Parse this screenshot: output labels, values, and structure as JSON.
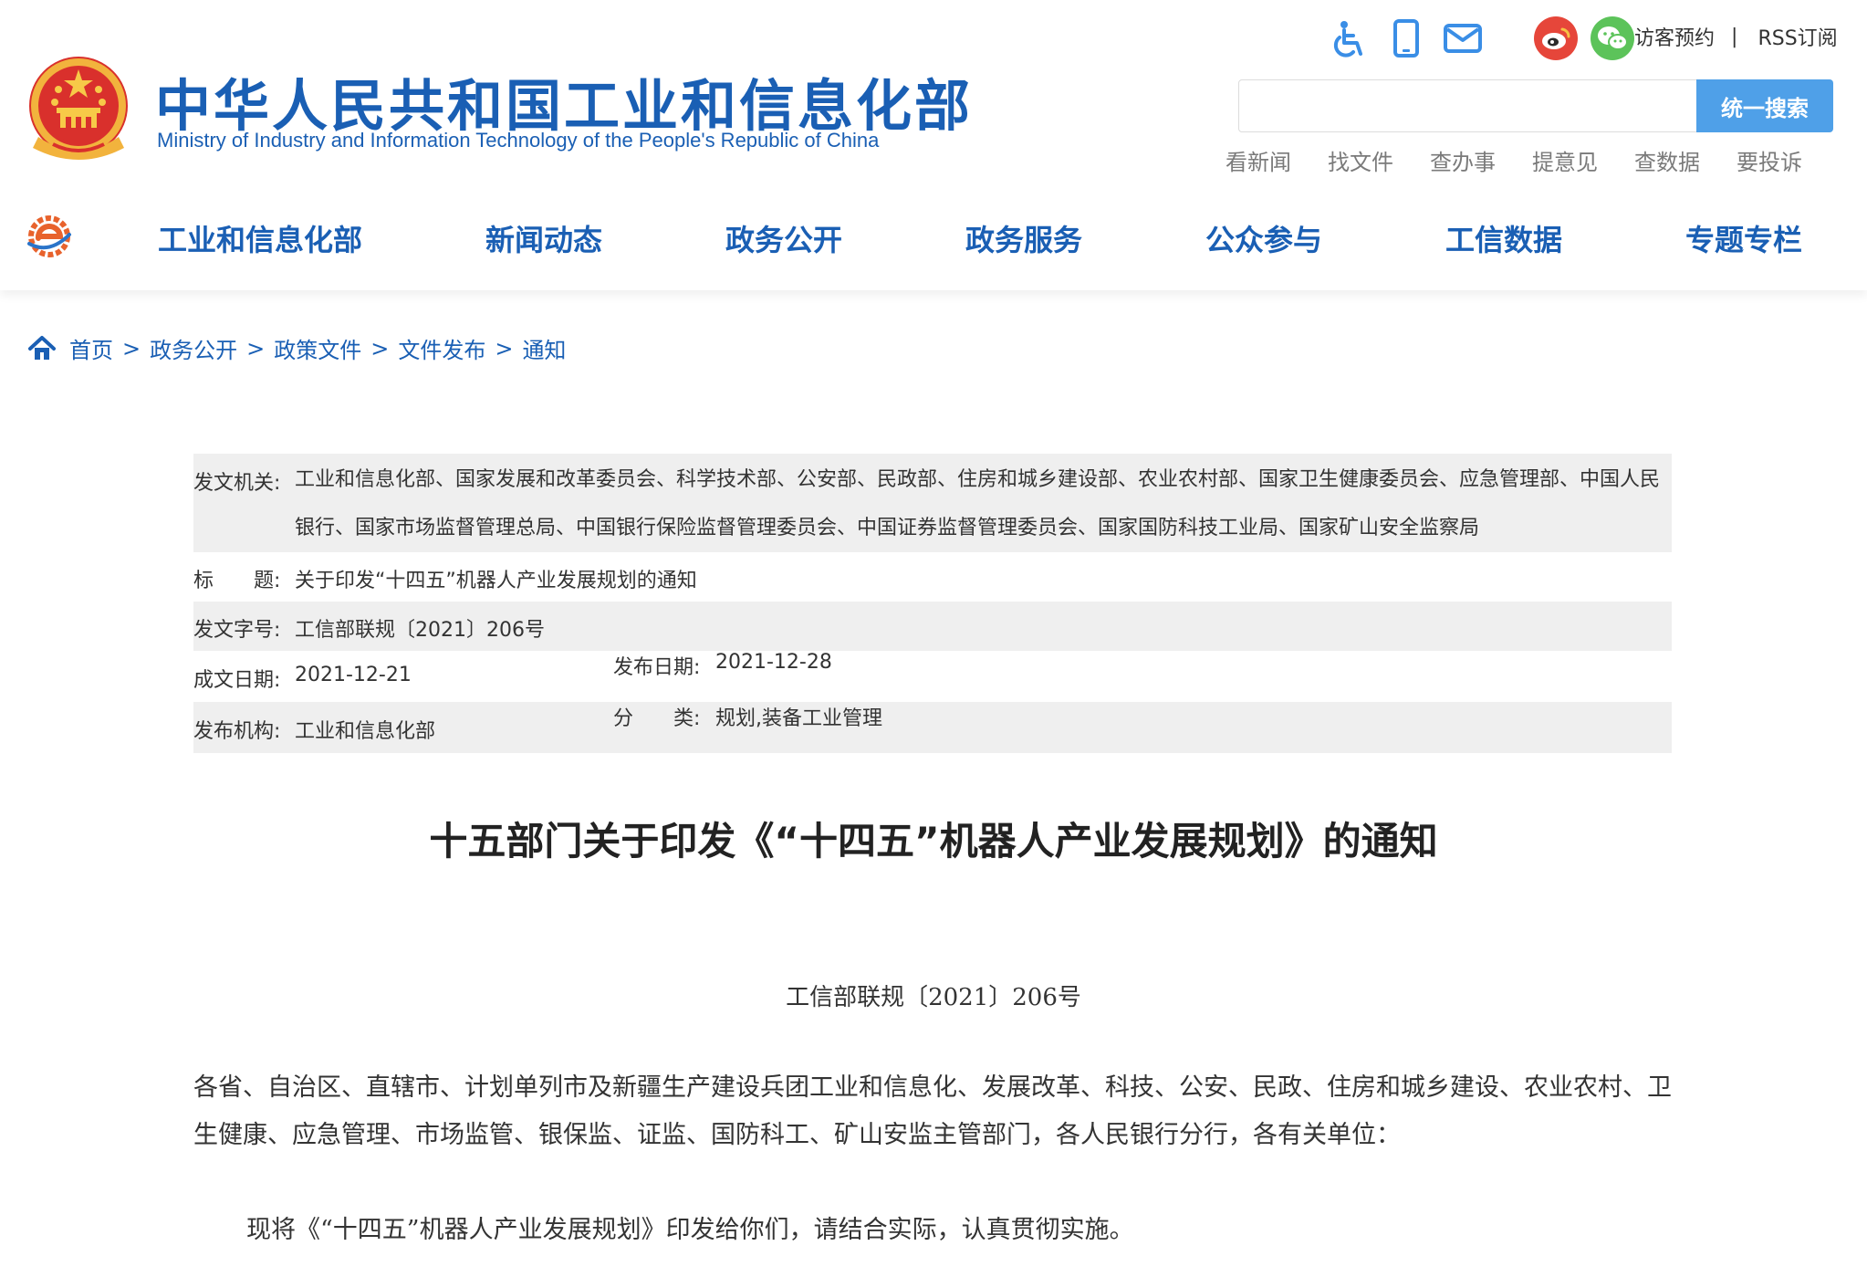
{
  "header": {
    "title": "中华人民共和国工业和信息化部",
    "subtitle": "Ministry of Industry and Information Technology of the People's Republic of China",
    "top_icons": [
      "accessibility-icon",
      "mobile-icon",
      "mail-icon",
      "weibo-icon",
      "wechat-icon"
    ],
    "top_links": [
      "访客预约",
      "RSS订阅"
    ],
    "top_links_separator": "|",
    "search": {
      "placeholder": "",
      "button_label": "统一搜索"
    },
    "quick_links": [
      "看新闻",
      "找文件",
      "查办事",
      "提意见",
      "查数据",
      "要投诉"
    ]
  },
  "nav": {
    "items": [
      "工业和信息化部",
      "新闻动态",
      "政务公开",
      "政务服务",
      "公众参与",
      "工信数据",
      "专题专栏"
    ]
  },
  "breadcrumb": {
    "items": [
      "首页",
      "政务公开",
      "政策文件",
      "文件发布",
      "通知"
    ],
    "separator": ">"
  },
  "info": {
    "issuer_label": "发文机关:",
    "issuer": "工业和信息化部、国家发展和改革委员会、科学技术部、公安部、民政部、住房和城乡建设部、农业农村部、国家卫生健康委员会、应急管理部、中国人民银行、国家市场监督管理总局、中国银行保险监督管理委员会、中国证券监督管理委员会、国家国防科技工业局、国家矿山安全监察局",
    "title_label": "标　　题:",
    "title": "关于印发“十四五”机器人产业发展规划的通知",
    "doc_no_label": "发文字号:",
    "doc_no": "工信部联规〔2021〕206号",
    "written_date_label": "成文日期:",
    "written_date": "2021-12-21",
    "publish_date_label": "发布日期:",
    "publish_date": "2021-12-28",
    "publisher_label": "发布机构:",
    "publisher": "工业和信息化部",
    "category_label": "分　　类:",
    "category": "规划,装备工业管理"
  },
  "document": {
    "title": "十五部门关于印发《“十四五”机器人产业发展规划》的通知",
    "number": "工信部联规〔2021〕206号",
    "addressee": "各省、自治区、直辖市、计划单列市及新疆生产建设兵团工业和信息化、发展改革、科技、公安、民政、住房和城乡建设、农业农村、卫生健康、应急管理、市场监管、银保监、证监、国防科工、矿山安监主管部门，各人民银行分行，各有关单位：",
    "body": "现将《“十四五”机器人产业发展规划》印发给你们，请结合实际，认真贯彻实施。"
  },
  "colors": {
    "brand_blue": "#1a5fb4",
    "search_button": "#4fa0e8",
    "row_gray": "#efefef",
    "weibo": "#e6463a",
    "wechat": "#5cc35a"
  }
}
